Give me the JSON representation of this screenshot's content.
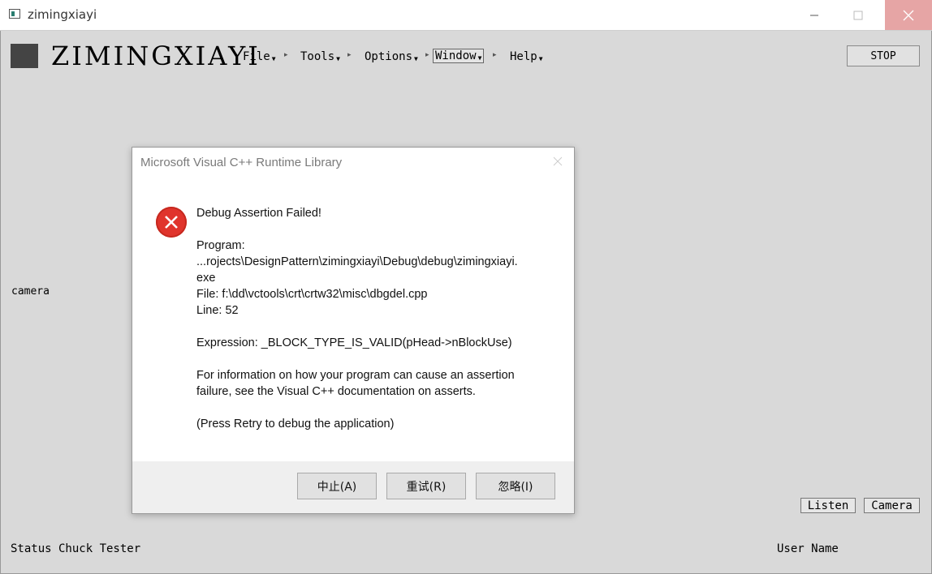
{
  "window": {
    "title": "zimingxiayi"
  },
  "app": {
    "name": "ZIMINGXIAYI",
    "menu": [
      {
        "label": "File"
      },
      {
        "label": "Tools"
      },
      {
        "label": "Options"
      },
      {
        "label": "Window"
      },
      {
        "label": "Help"
      }
    ],
    "stop_label": "STOP",
    "camera_label": "camera",
    "listen_label": "Listen",
    "camera_button_label": "Camera",
    "status_left": "Status Chuck Tester",
    "status_right": "User Name"
  },
  "dialog": {
    "title": "Microsoft Visual C++ Runtime Library",
    "heading": "Debug Assertion Failed!",
    "program_label": "Program:",
    "program_path": "...rojects\\DesignPattern\\zimingxiayi\\Debug\\debug\\zimingxiayi.",
    "program_ext": "exe",
    "file_line": "File: f:\\dd\\vctools\\crt\\crtw32\\misc\\dbgdel.cpp",
    "line_line": "Line: 52",
    "expression": "Expression: _BLOCK_TYPE_IS_VALID(pHead->nBlockUse)",
    "info_1": "For information on how your program can cause an assertion",
    "info_2": "failure, see the Visual C++ documentation on asserts.",
    "retry_hint": "(Press Retry to debug the application)",
    "buttons": {
      "abort": "中止(A)",
      "retry": "重试(R)",
      "ignore": "忽略(I)"
    }
  },
  "colors": {
    "error_red": "#e0342c",
    "close_hover": "#e6a5a5",
    "background": "#d9d9d9"
  }
}
